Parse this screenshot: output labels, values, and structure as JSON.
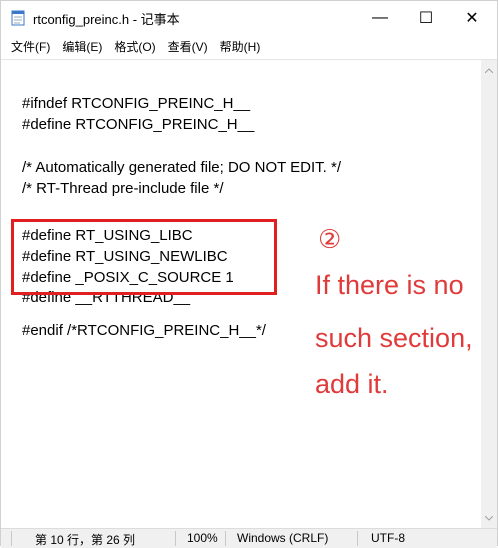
{
  "window": {
    "title": "rtconfig_preinc.h - 记事本",
    "controls": {
      "minimize": "—",
      "maximize": "☐",
      "close": "✕"
    }
  },
  "menu": {
    "items": [
      "文件(F)",
      "编辑(E)",
      "格式(O)",
      "查看(V)",
      "帮助(H)"
    ]
  },
  "editor": {
    "lines": [
      "#ifndef RTCONFIG_PREINC_H__",
      "#define RTCONFIG_PREINC_H__",
      "",
      "/* Automatically generated file; DO NOT EDIT. */",
      "/* RT-Thread pre-include file */",
      "",
      "#define RT_USING_LIBC",
      "#define RT_USING_NEWLIBC",
      "#define _POSIX_C_SOURCE 1",
      "#define __RTTHREAD__",
      "",
      "#endif /*RTCONFIG_PREINC_H__*/"
    ]
  },
  "status": {
    "position": "第 10 行，第 26 列",
    "zoom": "100%",
    "line_ending": "Windows (CRLF)",
    "encoding": "UTF-8"
  },
  "annotation": {
    "marker": "②",
    "lines": [
      "If there is no",
      "such section,",
      "add it."
    ],
    "color": "#e02020"
  }
}
